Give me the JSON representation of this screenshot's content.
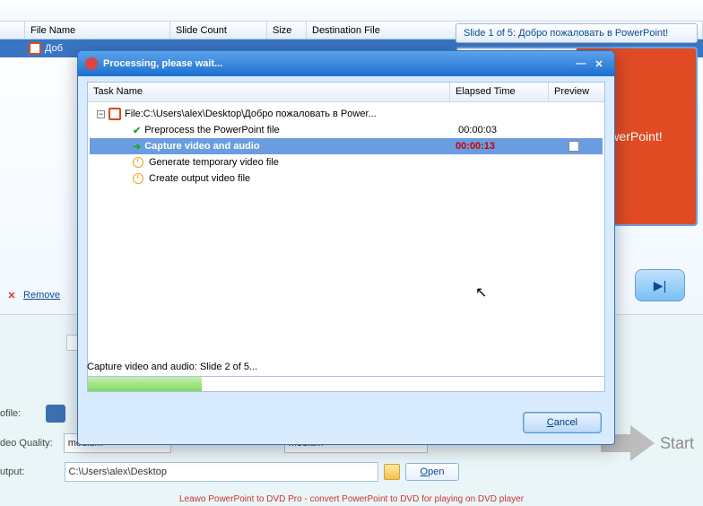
{
  "main_list": {
    "cols": {
      "file": "File Name",
      "slides": "Slide Count",
      "size": "Size",
      "dest": "Destination File"
    },
    "selected_file": "Доб"
  },
  "preview": {
    "caption": "Slide 1 of 5: Добро пожаловать в PowerPoint!",
    "orange_text": "werPoint!"
  },
  "remove": {
    "label": "Remove"
  },
  "form": {
    "profile_label": "ofile:",
    "quality_label": "deo Quality:",
    "quality_value": "medium",
    "quality2_value": "medium",
    "output_label": "utput:",
    "output_value": "C:\\Users\\alex\\Desktop",
    "open_label": "Open",
    "open_u": "O"
  },
  "start_label": "Start",
  "footer": "Leawo PowerPoint to DVD Pro - convert PowerPoint to DVD for playing on DVD player",
  "dialog": {
    "title": "Processing, please wait...",
    "cols": {
      "task": "Task Name",
      "elapsed": "Elapsed Time",
      "preview": "Preview"
    },
    "root": "File:C:\\Users\\alex\\Desktop\\Добро пожаловать в Power...",
    "tasks": [
      {
        "label": "Preprocess the PowerPoint file",
        "time": "00:00:03",
        "state": "done"
      },
      {
        "label": "Capture video and audio",
        "time": "00:00:13",
        "state": "active"
      },
      {
        "label": "Generate temporary video file",
        "time": "",
        "state": "pending"
      },
      {
        "label": "Create output video file",
        "time": "",
        "state": "pending"
      }
    ],
    "status": "Capture video and audio: Slide 2 of 5...",
    "cancel": "Cancel",
    "cancel_u": "C"
  }
}
